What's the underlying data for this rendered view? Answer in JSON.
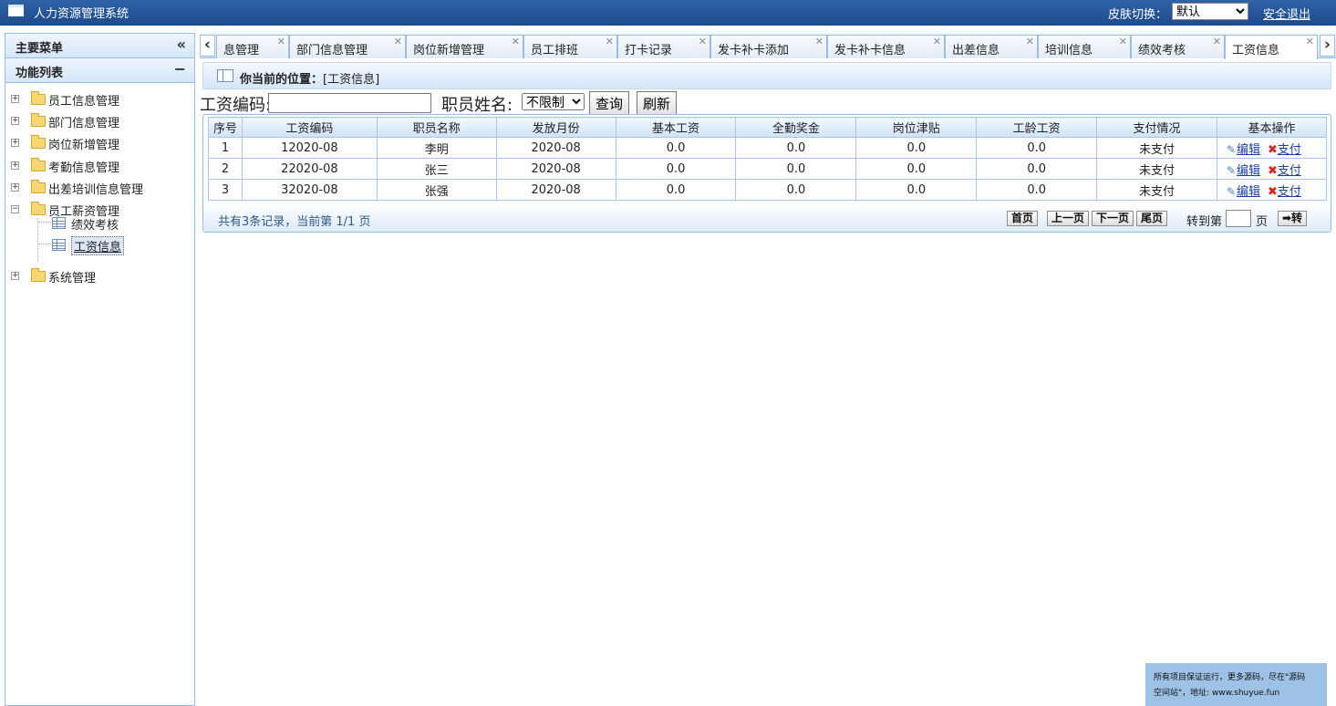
{
  "app": {
    "title": "人力资源管理系统"
  },
  "header": {
    "skin_label": "皮肤切换：",
    "skin_selected": "默认",
    "logout": "安全退出"
  },
  "sidebar": {
    "main_menu": "主要菜单",
    "collapse_glyph": "«",
    "function_list": "功能列表",
    "minus_glyph": "−",
    "items": [
      {
        "label": "员工信息管理"
      },
      {
        "label": "部门信息管理"
      },
      {
        "label": "岗位新增管理"
      },
      {
        "label": "考勤信息管理"
      },
      {
        "label": "出差培训信息管理"
      },
      {
        "label": "员工薪资管理",
        "children": [
          {
            "label": "绩效考核"
          },
          {
            "label": "工资信息"
          }
        ]
      },
      {
        "label": "系统管理"
      }
    ]
  },
  "tabs": [
    {
      "label": "息管理"
    },
    {
      "label": "部门信息管理"
    },
    {
      "label": "岗位新增管理"
    },
    {
      "label": "员工排班"
    },
    {
      "label": "打卡记录"
    },
    {
      "label": "发卡补卡添加"
    },
    {
      "label": "发卡补卡信息"
    },
    {
      "label": "出差信息"
    },
    {
      "label": "培训信息"
    },
    {
      "label": "绩效考核"
    },
    {
      "label": "工资信息"
    }
  ],
  "location": {
    "prefix": "你当前的位置：",
    "path": "[工资信息]"
  },
  "search": {
    "code_label": "工资编码:",
    "code_value": "",
    "name_label": "职员姓名:",
    "name_selected": "不限制",
    "query_button": "查询",
    "refresh_button": "刷新"
  },
  "table": {
    "columns": [
      "序号",
      "工资编码",
      "职员名称",
      "发放月份",
      "基本工资",
      "全勤奖金",
      "岗位津贴",
      "工龄工资",
      "支付情况",
      "基本操作"
    ],
    "rows": [
      [
        "1",
        "12020-08",
        "李明",
        "2020-08",
        "0.0",
        "0.0",
        "0.0",
        "0.0",
        "未支付"
      ],
      [
        "2",
        "22020-08",
        "张三",
        "2020-08",
        "0.0",
        "0.0",
        "0.0",
        "0.0",
        "未支付"
      ],
      [
        "3",
        "32020-08",
        "张强",
        "2020-08",
        "0.0",
        "0.0",
        "0.0",
        "0.0",
        "未支付"
      ]
    ],
    "edit_label": "编辑",
    "pay_label": "支付"
  },
  "pager": {
    "info": "共有3条记录，当前第 1/1 页",
    "first": "首页",
    "prev": "上一页",
    "next": "下一页",
    "last": "尾页",
    "goto_label": "转到第",
    "page_suffix": "页",
    "go_button": "➡转"
  },
  "watermark": {
    "line1": "所有项目保证运行，更多源码，尽在\"源码",
    "line2": "空间站\"，地址: www.shuyue.fun"
  }
}
